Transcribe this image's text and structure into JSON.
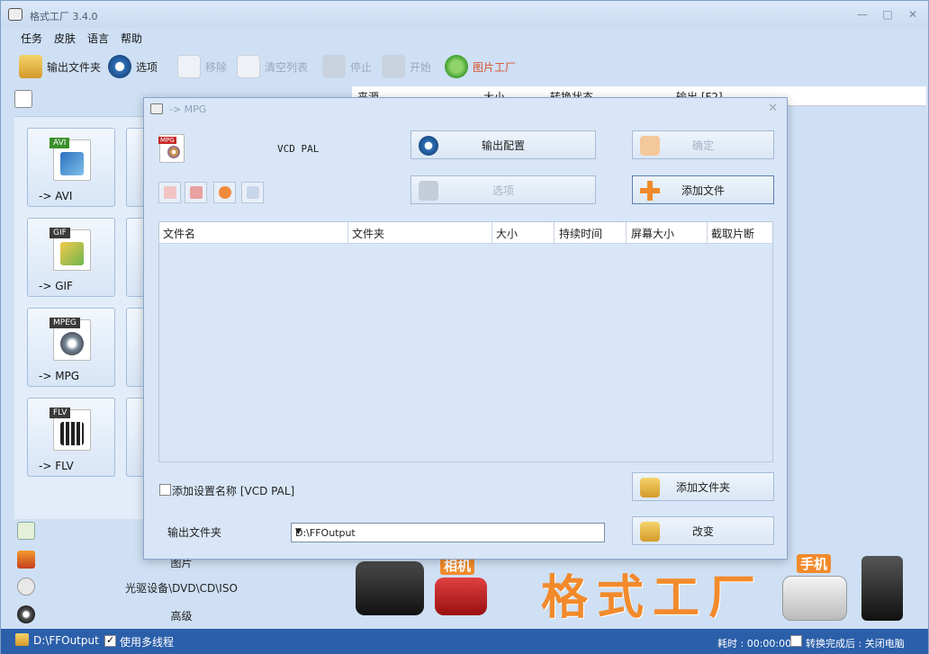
{
  "app": {
    "title": "格式工厂 3.4.0",
    "window_controls": [
      "—",
      "□",
      "✕"
    ]
  },
  "menu": [
    "任务",
    "皮肤",
    "语言",
    "帮助"
  ],
  "toolbar": {
    "output_folder": "输出文件夹",
    "options": "选项",
    "remove": "移除",
    "clear_list": "清空列表",
    "stop": "停止",
    "start": "开始",
    "picture_factory": "图片工厂"
  },
  "formats": [
    {
      "tag": "AVI",
      "label": "-> AVI"
    },
    {
      "tag": "GIF",
      "label": "-> GIF"
    },
    {
      "tag": "MPEG",
      "label": "-> MPG"
    },
    {
      "tag": "FLV",
      "label": "-> FLV"
    }
  ],
  "categories": {
    "picture": "图片",
    "disc": "光驱设备\\DVD\\CD\\ISO",
    "advanced": "高级"
  },
  "task_table": {
    "headers": [
      "来源",
      "大小",
      "转换状态",
      "输出 [F2]"
    ]
  },
  "banner": {
    "title": "格式工厂",
    "camera": "相机",
    "phone": "手机"
  },
  "status": {
    "output_path": "D:\\FFOutput",
    "multithread": "使用多线程",
    "elapsed": "耗时 : 00:00:00",
    "after_done": "转换完成后 : 关闭电脑"
  },
  "dialog": {
    "title": "-> MPG",
    "preset": "VCD PAL",
    "output_config": "输出配置",
    "ok": "确定",
    "options": "选项",
    "add_file": "添加文件",
    "add_folder": "添加文件夹",
    "change": "改变",
    "file_headers": [
      "文件名",
      "文件夹",
      "大小",
      "持续时间",
      "屏幕大小",
      "截取片断"
    ],
    "add_setting_name": "添加设置名称 [VCD PAL]",
    "output_folder_label": "输出文件夹",
    "output_folder_value": "D:\\FFOutput"
  }
}
